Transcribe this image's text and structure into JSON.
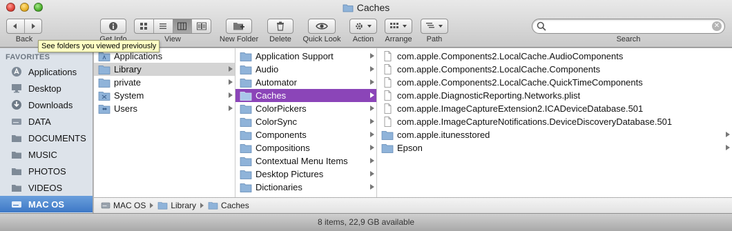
{
  "window": {
    "title": "Caches"
  },
  "toolbar": {
    "back_label": "Back",
    "getinfo_label": "Get Info",
    "view_label": "View",
    "newfolder_label": "New Folder",
    "delete_label": "Delete",
    "quicklook_label": "Quick Look",
    "action_label": "Action",
    "arrange_label": "Arrange",
    "path_label": "Path",
    "search_label": "Search",
    "search_value": ""
  },
  "tooltip": {
    "text": "See folders you viewed previously"
  },
  "sidebar": {
    "heading": "FAVORITES",
    "items": [
      {
        "label": "Applications",
        "icon": "applications-icon"
      },
      {
        "label": "Desktop",
        "icon": "desktop-icon"
      },
      {
        "label": "Downloads",
        "icon": "downloads-icon"
      },
      {
        "label": "DATA",
        "icon": "drive-icon"
      },
      {
        "label": "DOCUMENTS",
        "icon": "folder-icon"
      },
      {
        "label": "MUSIC",
        "icon": "folder-icon"
      },
      {
        "label": "PHOTOS",
        "icon": "folder-icon"
      },
      {
        "label": "VIDEOS",
        "icon": "folder-icon"
      },
      {
        "label": "MAC OS",
        "icon": "drive-icon",
        "selected": true
      }
    ]
  },
  "columns": {
    "col1": [
      "Applications",
      "Library",
      "private",
      "System",
      "Users"
    ],
    "col2": [
      "Application Support",
      "Audio",
      "Automator",
      "Caches",
      "ColorPickers",
      "ColorSync",
      "Components",
      "Compositions",
      "Contextual Menu Items",
      "Desktop Pictures",
      "Dictionaries"
    ],
    "col3": [
      "com.apple.Components2.LocalCache.AudioComponents",
      "com.apple.Components2.LocalCache.Components",
      "com.apple.Components2.LocalCache.QuickTimeComponents",
      "com.apple.DiagnosticReporting.Networks.plist",
      "com.apple.ImageCaptureExtension2.ICADeviceDatabase.501",
      "com.apple.ImageCaptureNotifications.DeviceDiscoveryDatabase.501",
      "com.apple.itunesstored",
      "Epson"
    ]
  },
  "pathbar": {
    "items": [
      "MAC OS",
      "Library",
      "Caches"
    ]
  },
  "status": {
    "text": "8 items, 22,9 GB available"
  },
  "colors": {
    "selection_purple": "#8b45b8",
    "sidebar_selection": "#3e78c6",
    "tooltip_bg": "#ffffc4"
  }
}
